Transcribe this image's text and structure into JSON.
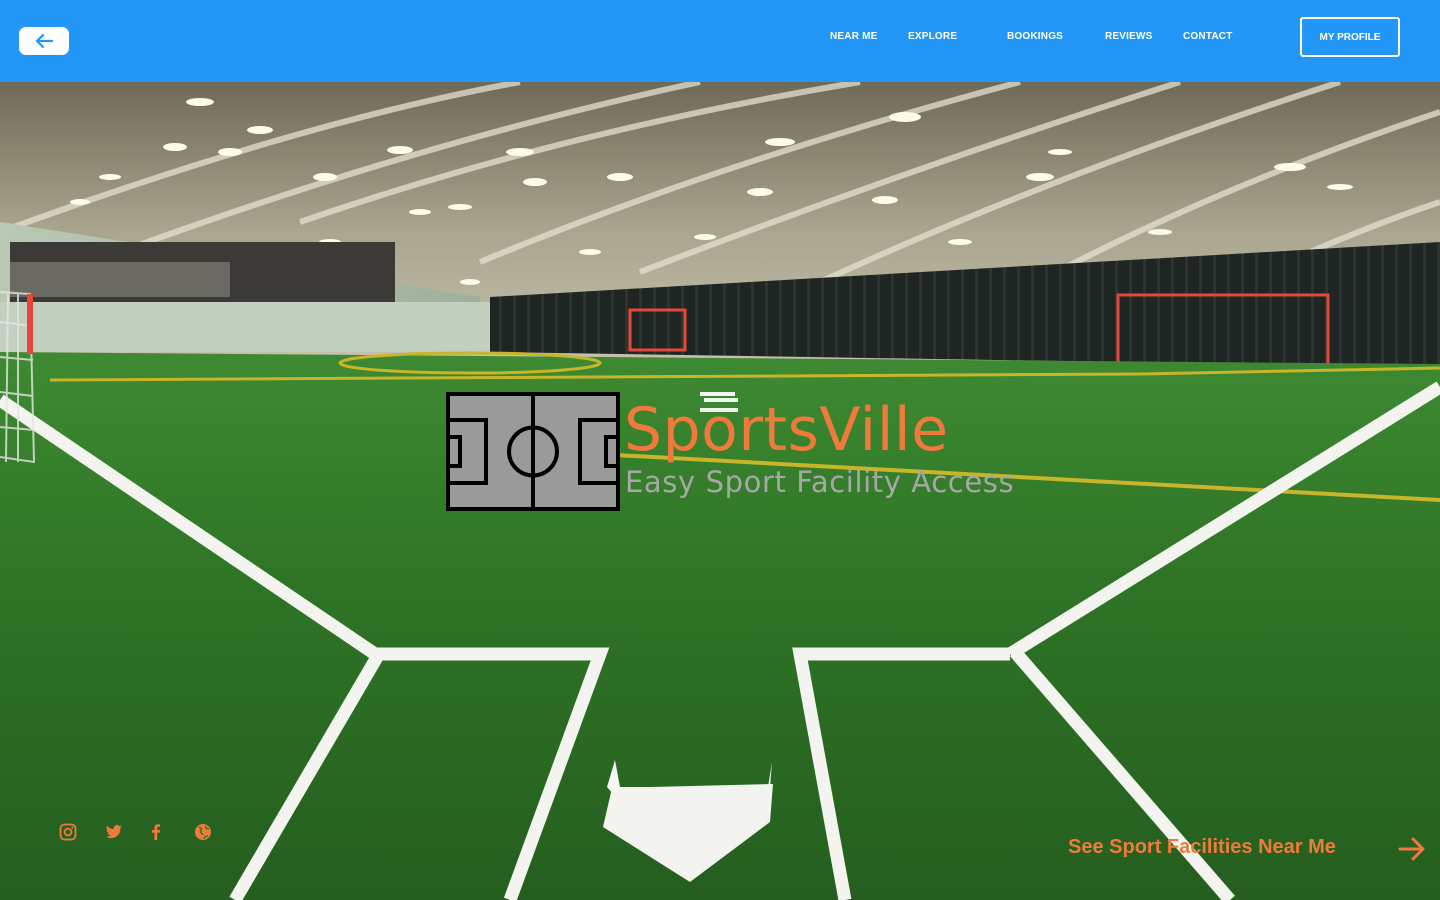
{
  "nav": {
    "back_icon": "arrow-left-icon",
    "links": [
      "NEAR ME",
      "EXPLORE",
      "BOOKINGS",
      "REVIEWS",
      "CONTACT"
    ],
    "profile_label": "MY PROFILE",
    "bar_color": "#2397f7"
  },
  "brand": {
    "logo_icon": "soccer-field-icon",
    "title": "SportsVille",
    "tagline": "Easy Sport Facility Access",
    "title_color": "#f07a3c",
    "tagline_color": "#a7a7a7"
  },
  "social": {
    "icons": [
      "instagram-icon",
      "twitter-icon",
      "facebook-icon",
      "globe-icon"
    ],
    "color": "#f07a3c"
  },
  "cta": {
    "label": "See Sport Facilities Near Me",
    "icon": "arrow-right-icon"
  },
  "hero": {
    "image": "indoor turf sports field"
  }
}
